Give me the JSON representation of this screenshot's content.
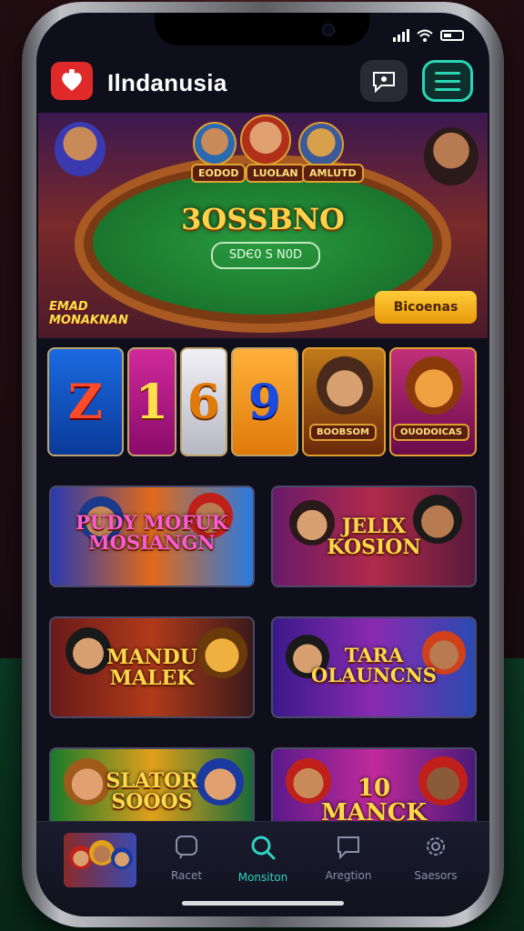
{
  "status_bar": {
    "signal": "signal-icon",
    "wifi": "wifi-icon",
    "battery": "battery-icon"
  },
  "header": {
    "logo_icon": "card-suit-logo-icon",
    "app_name": "Ilndanusia",
    "chat_button_icon": "chat-bubble-icon",
    "menu_button_icon": "hamburger-menu-icon",
    "accent": "#29d6b6"
  },
  "hero": {
    "title": "3OSSBNO",
    "subtitle": "SDЄ0 S N0D",
    "cta_label": "Bicoenas",
    "sticker": "EMAD\nMONAKNAN",
    "plaques": [
      "EODOD",
      "LUOLAN",
      "AMLUTD"
    ]
  },
  "slot_row": {
    "reels": [
      "Z",
      "1",
      "6",
      "9"
    ],
    "tiles": [
      {
        "label": "BOOBSOM"
      },
      {
        "label": "OUODOICAS"
      }
    ]
  },
  "game_cards": [
    {
      "title": "PUDY MOFUK MOSIANGN"
    },
    {
      "title": "JELIX KOSION"
    },
    {
      "title": "MANDU MALEK"
    },
    {
      "title": "TARA OLAUNCNS"
    },
    {
      "title": "SLATOR SOOOS"
    },
    {
      "title": "10 MANCK"
    }
  ],
  "tab_bar": {
    "tabs": [
      {
        "label": "Racet",
        "icon": "chat-square-icon"
      },
      {
        "label": "Monsiton",
        "icon": "search-icon",
        "active": true
      },
      {
        "label": "Aregtion",
        "icon": "message-icon"
      },
      {
        "label": "Saesors",
        "icon": "settings-gear-icon"
      }
    ],
    "active_color": "#2ed3c4"
  }
}
